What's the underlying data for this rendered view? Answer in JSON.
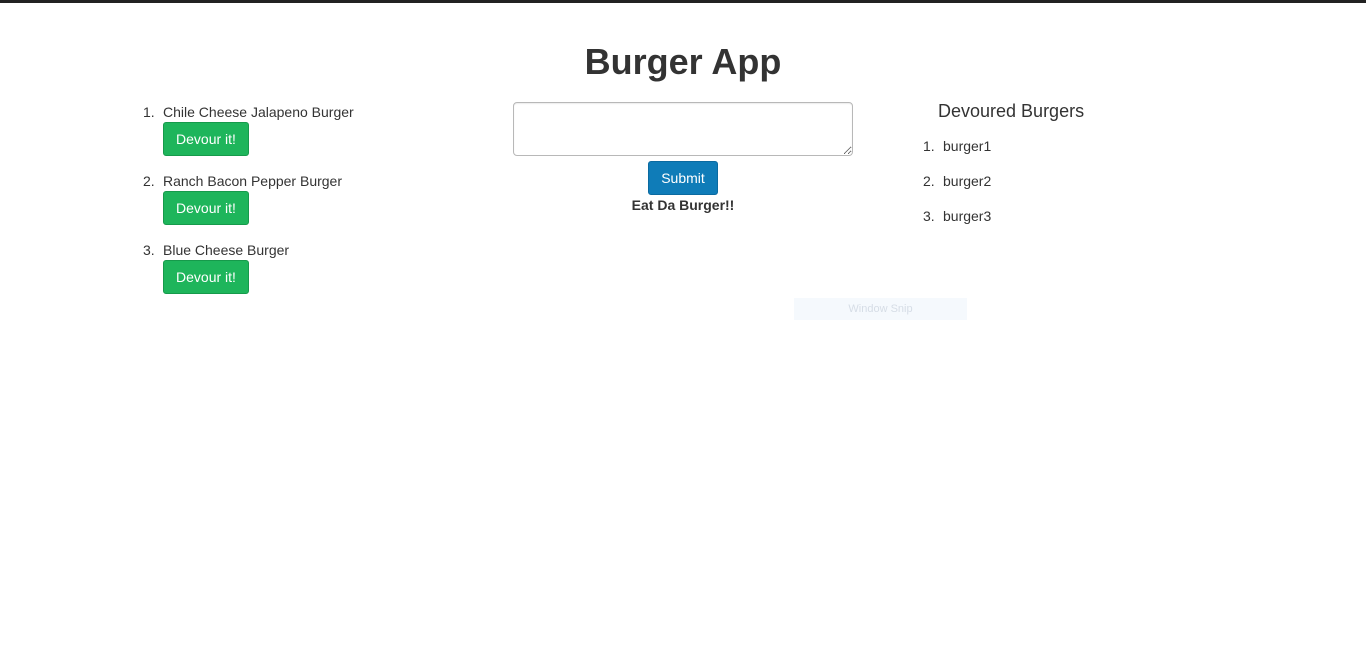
{
  "app": {
    "title": "Burger App"
  },
  "burgers": [
    {
      "number": "1.",
      "name": "Chile Cheese Jalapeno Burger",
      "button_label": "Devour it!"
    },
    {
      "number": "2.",
      "name": "Ranch Bacon Pepper Burger",
      "button_label": "Devour it!"
    },
    {
      "number": "3.",
      "name": "Blue Cheese Burger",
      "button_label": "Devour it!"
    }
  ],
  "form": {
    "input_value": "",
    "submit_label": "Submit",
    "caption": "Eat Da Burger!!"
  },
  "overlay": {
    "label": "Window Snip"
  },
  "devoured": {
    "title": "Devoured Burgers",
    "items": [
      {
        "number": "1.",
        "name": "burger1"
      },
      {
        "number": "2.",
        "name": "burger2"
      },
      {
        "number": "3.",
        "name": "burger3"
      }
    ]
  },
  "colors": {
    "devour_button": "#1eb55b",
    "submit_button": "#0f7cb8",
    "text": "#333333",
    "top_bar": "#222222"
  }
}
